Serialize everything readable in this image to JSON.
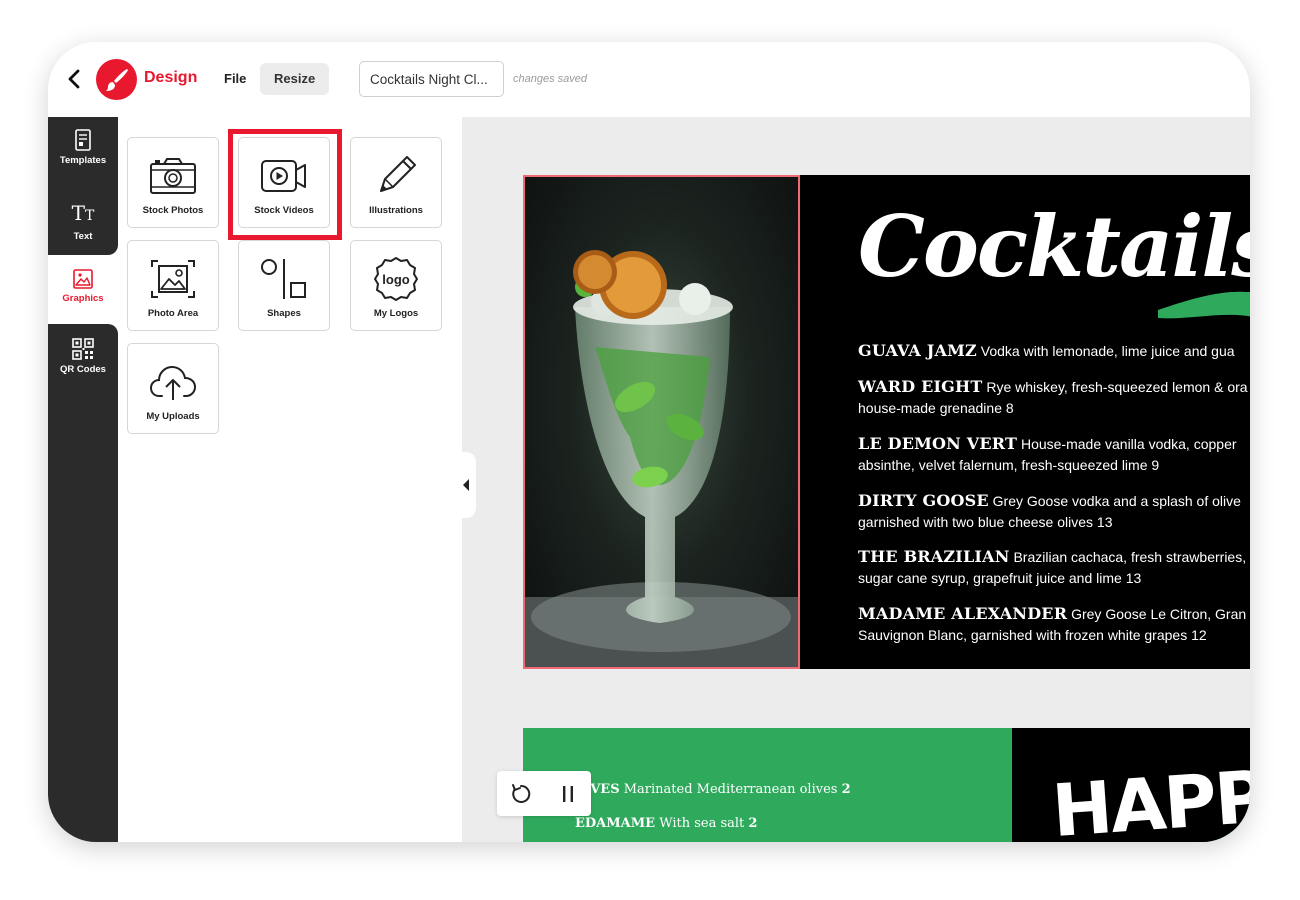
{
  "header": {
    "brand": "Design",
    "menu_file": "File",
    "menu_resize": "Resize",
    "doc_title": "Cocktails Night Cl...",
    "save_status": "changes saved"
  },
  "leftnav": {
    "items": [
      {
        "label": "Templates",
        "icon": "templates-icon"
      },
      {
        "label": "Text",
        "icon": "text-icon"
      },
      {
        "label": "Graphics",
        "icon": "graphics-icon",
        "active": true
      },
      {
        "label": "QR Codes",
        "icon": "qr-code-icon"
      }
    ]
  },
  "graphics_panel": {
    "tiles": [
      {
        "label": "Stock Photos",
        "icon": "camera-icon"
      },
      {
        "label": "Stock Videos",
        "icon": "video-icon",
        "highlighted": true
      },
      {
        "label": "Illustrations",
        "icon": "pencil-icon"
      },
      {
        "label": "Photo Area",
        "icon": "photo-area-icon"
      },
      {
        "label": "Shapes",
        "icon": "shapes-icon"
      },
      {
        "label": "My Logos",
        "icon": "logo-icon",
        "icon_text": "logo"
      },
      {
        "label": "My Uploads",
        "icon": "cloud-upload-icon"
      }
    ]
  },
  "canvas": {
    "page1": {
      "title": "Cocktails",
      "items": [
        {
          "name": "GUAVA JAMZ",
          "desc": "Vodka with lemonade, lime juice and gua"
        },
        {
          "name": "WARD EIGHT",
          "desc": "Rye whiskey, fresh-squeezed lemon & ora",
          "desc2": "house-made grenadine 8"
        },
        {
          "name": "LE DEMON VERT",
          "desc": "House-made vanilla vodka, copper",
          "desc2": "absinthe, velvet falernum, fresh-squeezed lime 9"
        },
        {
          "name": "DIRTY GOOSE",
          "desc": "Grey Goose vodka and a splash of olive",
          "desc2": "garnished with two blue cheese olives 13"
        },
        {
          "name": "THE BRAZILIAN",
          "desc": "Brazilian cachaca, fresh strawberries,",
          "desc2": "sugar cane syrup, grapefruit juice and lime 13"
        },
        {
          "name": "MADAME ALEXANDER",
          "desc": "Grey Goose Le Citron, Gran",
          "desc2": "Sauvignon Blanc, garnished with frozen white grapes 12"
        }
      ]
    },
    "page2": {
      "title": "HAPPY",
      "items": [
        {
          "name": "LIVES",
          "desc": "Marinated Mediterranean olives",
          "price": "2"
        },
        {
          "name": "EDAMAME",
          "desc": "With sea salt",
          "price": "2"
        }
      ]
    }
  },
  "colors": {
    "accent": "#e8182f",
    "nav_bg": "#2b2b2b",
    "canvas_bg": "#ececec",
    "menu_green": "#2faa5d"
  }
}
